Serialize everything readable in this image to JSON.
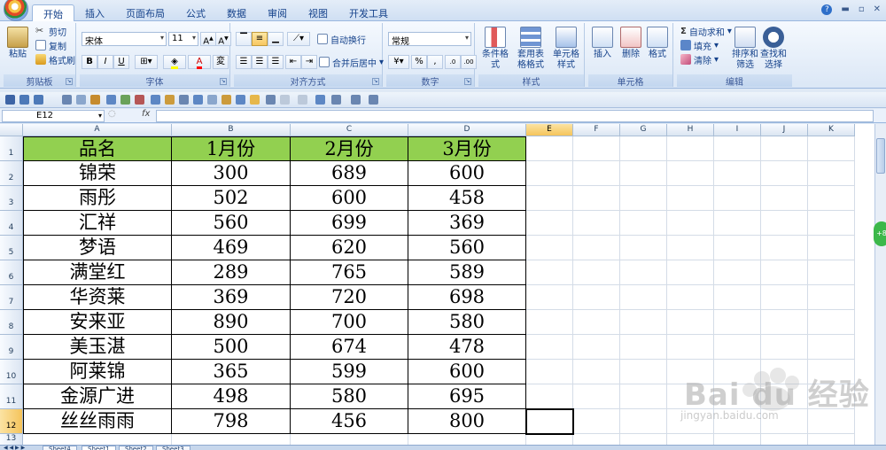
{
  "tabs": [
    "开始",
    "插入",
    "页面布局",
    "公式",
    "数据",
    "审阅",
    "视图",
    "开发工具"
  ],
  "active_tab": 0,
  "clipboard": {
    "paste": "粘贴",
    "cut": "剪切",
    "copy": "复制",
    "format_painter": "格式刷",
    "title": "剪贴板"
  },
  "font": {
    "name": "宋体",
    "size": "11",
    "bold": "B",
    "italic": "I",
    "underline": "U",
    "title": "字体"
  },
  "alignment": {
    "wrap": "自动换行",
    "merge": "合并后居中",
    "title": "对齐方式"
  },
  "number": {
    "format": "常规",
    "title": "数字"
  },
  "styles": {
    "conditional": "条件格式",
    "table": "套用表格格式",
    "cell_styles": "单元格样式",
    "title": "样式"
  },
  "cells_group": {
    "insert": "插入",
    "delete": "删除",
    "format": "格式",
    "title": "单元格"
  },
  "editing": {
    "autosum": "自动求和",
    "fill": "填充",
    "clear": "清除",
    "sort": "排序和筛选",
    "find": "查找和选择",
    "title": "编辑"
  },
  "name_box": "E12",
  "fx_label": "fx",
  "columns": [
    "A",
    "B",
    "C",
    "D",
    "E",
    "F",
    "G",
    "H",
    "I",
    "J",
    "K"
  ],
  "rows": [
    "1",
    "2",
    "3",
    "4",
    "5",
    "6",
    "7",
    "8",
    "9",
    "10",
    "11",
    "12",
    "13"
  ],
  "table": {
    "header": [
      "品名",
      "1月份",
      "2月份",
      "3月份"
    ],
    "body": [
      [
        "锦荣",
        "300",
        "689",
        "600"
      ],
      [
        "雨彤",
        "502",
        "600",
        "458"
      ],
      [
        "汇祥",
        "560",
        "699",
        "369"
      ],
      [
        "梦语",
        "469",
        "620",
        "560"
      ],
      [
        "满堂红",
        "289",
        "765",
        "589"
      ],
      [
        "华资莱",
        "369",
        "720",
        "698"
      ],
      [
        "安来亚",
        "890",
        "700",
        "580"
      ],
      [
        "美玉湛",
        "500",
        "674",
        "478"
      ],
      [
        "阿莱锦",
        "365",
        "599",
        "600"
      ],
      [
        "金源广进",
        "498",
        "580",
        "695"
      ],
      [
        "丝丝雨雨",
        "798",
        "456",
        "800"
      ]
    ]
  },
  "header_color": "#92d050",
  "selected_cell": "E12",
  "sheets": [
    "Sheet4",
    "Sheet1",
    "Sheet2",
    "Sheet3"
  ],
  "active_sheet": 1,
  "zoom_badge": "+8",
  "watermark": {
    "brand": "Bai du 经验",
    "url": "jingyan.baidu.com"
  }
}
